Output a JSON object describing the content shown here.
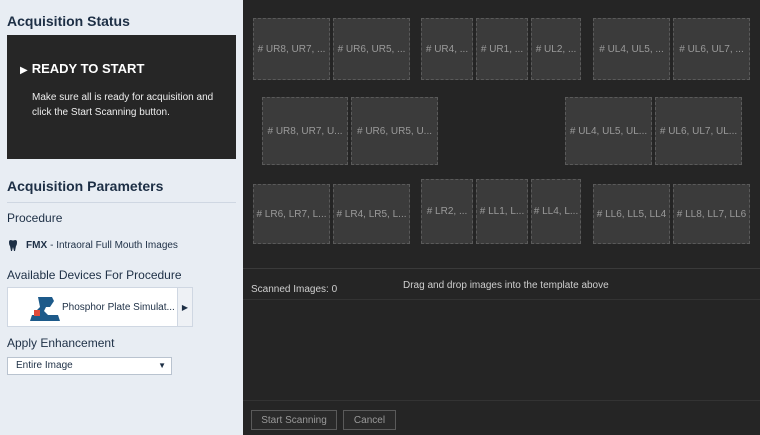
{
  "acquisition_status": {
    "heading": "Acquisition Status",
    "title": "READY TO START",
    "message": "Make sure all is ready for acquisition and click the Start Scanning button."
  },
  "parameters": {
    "heading": "Acquisition Parameters",
    "procedure_label": "Procedure",
    "procedure_code": "FMX",
    "procedure_desc": "- Intraoral Full Mouth Images",
    "devices_label": "Available Devices For Procedure",
    "device_name": "Phosphor Plate Simulat...",
    "enhancement_label": "Apply Enhancement",
    "enhancement_value": "Entire Image"
  },
  "template": {
    "row1": [
      "# UR8, UR7, ...",
      "# UR6, UR5, ...",
      "# UR4, ...",
      "# UR1, ...",
      "# UL2, ...",
      "# UL4, UL5, ...",
      "# UL6, UL7, ..."
    ],
    "row2": [
      "# UR8, UR7, U...",
      "# UR6, UR5, U...",
      "# UL4, UL5, UL...",
      "# UL6, UL7, UL..."
    ],
    "row3": [
      "# LR6, LR7, L...",
      "# LR4, LR5, L...",
      "# LR2, ...",
      "# LL1, L...",
      "# LL4, L...",
      "# LL6, LL5, LL4",
      "# LL8, LL7, LL6"
    ]
  },
  "scanned": {
    "count_text": "Scanned Images: 0",
    "hint": "Drag and drop images into the template above"
  },
  "actions": {
    "start_label": "Start Scanning",
    "cancel_label": "Cancel"
  },
  "colors": {
    "panel_bg": "#e8edf3",
    "dark_bg": "#252525",
    "slot_bg": "#3b3b3b",
    "heading": "#1d2f45"
  }
}
